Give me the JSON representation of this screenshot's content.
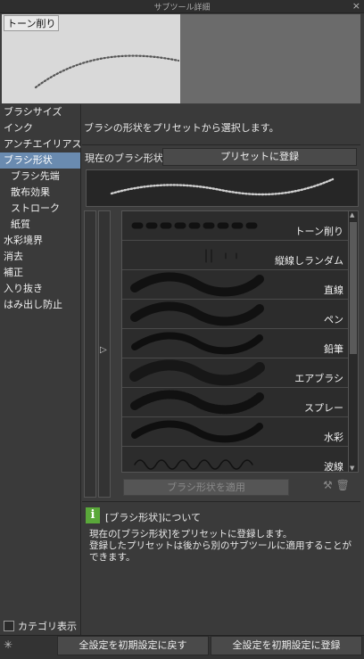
{
  "window": {
    "title": "サブツール詳細",
    "close": "×"
  },
  "preview": {
    "label": "トーン削り"
  },
  "nav": {
    "items": [
      {
        "label": "ブラシサイズ",
        "sub": false,
        "active": false
      },
      {
        "label": "インク",
        "sub": false,
        "active": false
      },
      {
        "label": "アンチエイリアス",
        "sub": false,
        "active": false
      },
      {
        "label": "ブラシ形状",
        "sub": false,
        "active": true
      },
      {
        "label": "ブラシ先端",
        "sub": true,
        "active": false
      },
      {
        "label": "散布効果",
        "sub": true,
        "active": false
      },
      {
        "label": "ストローク",
        "sub": true,
        "active": false
      },
      {
        "label": "紙質",
        "sub": true,
        "active": false
      },
      {
        "label": "水彩境界",
        "sub": false,
        "active": false
      },
      {
        "label": "消去",
        "sub": false,
        "active": false
      },
      {
        "label": "補正",
        "sub": false,
        "active": false
      },
      {
        "label": "入り抜き",
        "sub": false,
        "active": false
      },
      {
        "label": "はみ出し防止",
        "sub": false,
        "active": false
      }
    ],
    "category_display": "カテゴリ表示"
  },
  "panel": {
    "description": "ブラシの形状をプリセットから選択します。",
    "current_shape_label": "現在のブラシ形状",
    "register_preset": "プリセットに登録",
    "apply_button": "ブラシ形状を適用"
  },
  "presets": [
    {
      "name": "トーン削り",
      "style": "dots"
    },
    {
      "name": "縦線しランダム",
      "style": "vlines"
    },
    {
      "name": "直線",
      "style": "thick"
    },
    {
      "name": "ペン",
      "style": "thick"
    },
    {
      "name": "鉛筆",
      "style": "soft"
    },
    {
      "name": "エアブラシ",
      "style": "air"
    },
    {
      "name": "スプレー",
      "style": "spray"
    },
    {
      "name": "水彩",
      "style": "soft"
    },
    {
      "name": "波線",
      "style": "wave"
    }
  ],
  "info": {
    "icon": "i",
    "title": "[ブラシ形状]について",
    "lines": [
      "現在の[ブラシ形状]をプリセットに登録します。",
      "登録したプリセットは後から別のサブツールに適用することができます。"
    ]
  },
  "footer": {
    "reset_all": "全設定を初期設定に戻す",
    "register_all": "全設定を初期設定に登録"
  }
}
